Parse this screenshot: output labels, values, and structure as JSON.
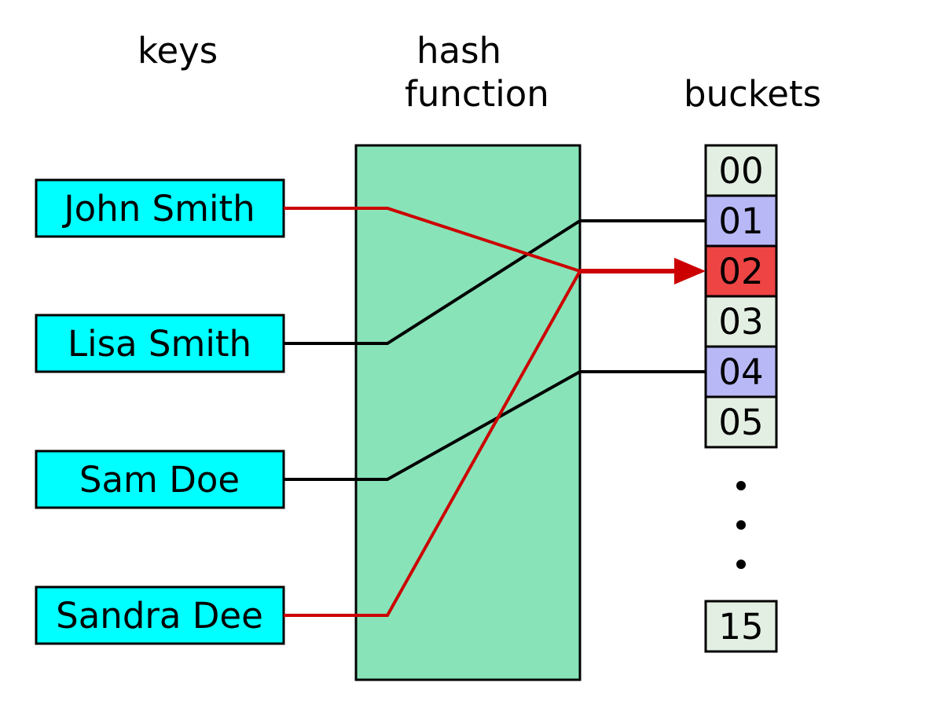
{
  "headers": {
    "keys": "keys",
    "hash_function": "hash\nfunction",
    "buckets": "buckets"
  },
  "keys": [
    {
      "name": "John Smith"
    },
    {
      "name": "Lisa Smith"
    },
    {
      "name": "Sam Doe"
    },
    {
      "name": "Sandra Dee"
    }
  ],
  "buckets": [
    {
      "label": "00",
      "style": "empty"
    },
    {
      "label": "01",
      "style": "purple"
    },
    {
      "label": "02",
      "style": "red"
    },
    {
      "label": "03",
      "style": "empty"
    },
    {
      "label": "04",
      "style": "purple"
    },
    {
      "label": "05",
      "style": "empty"
    },
    {
      "label": "15",
      "style": "empty"
    }
  ],
  "colors": {
    "key_fill": "#00ffff",
    "hash_fill": "#88e3b8",
    "bucket_empty": "#e3efe3",
    "bucket_purple": "#b8b8f7",
    "bucket_red": "#ee4444",
    "link_black": "#000000",
    "link_red": "#cc0000"
  },
  "mappings": [
    {
      "from_key": "John Smith",
      "to_bucket": "02",
      "color": "red",
      "collision": true
    },
    {
      "from_key": "Sandra Dee",
      "to_bucket": "02",
      "color": "red",
      "collision": true
    },
    {
      "from_key": "Lisa Smith",
      "to_bucket": "01",
      "color": "black",
      "collision": false
    },
    {
      "from_key": "Sam Doe",
      "to_bucket": "04",
      "color": "black",
      "collision": false
    }
  ]
}
